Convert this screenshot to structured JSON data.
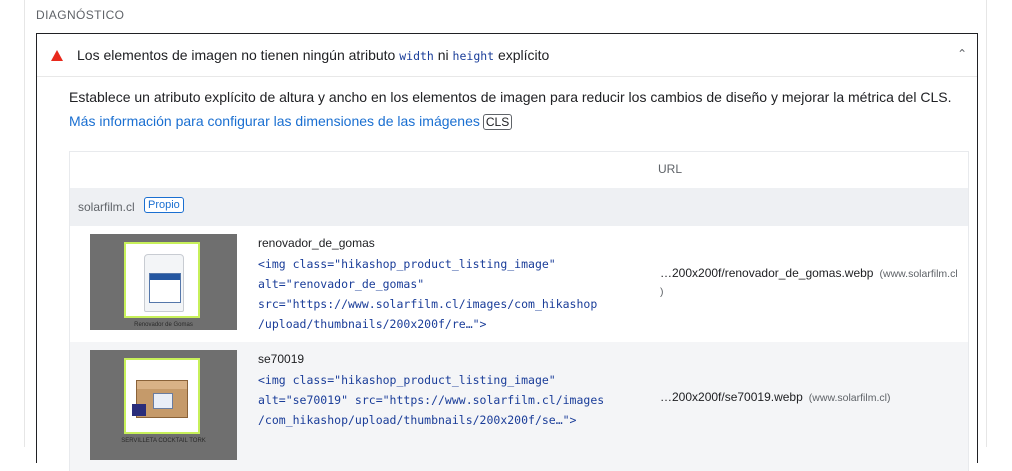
{
  "section": {
    "title": "DIAGNÓSTICO"
  },
  "audit": {
    "title_prefix": "Los elementos de imagen no tienen ningún atributo ",
    "code_width": "width",
    "title_middle": " ni ",
    "code_height": "height",
    "title_suffix": " explícito",
    "description": "Establece un atributo explícito de altura y ancho en los elementos de imagen para reducir los cambios de diseño y mejorar la métrica del CLS.",
    "learn_more": "Más información para configurar las dimensiones de las imágenes",
    "badge": "CLS",
    "icons": {
      "warning": "warning-triangle-icon",
      "collapse": "chevron-up-icon"
    },
    "colors": {
      "warning": "#e8291c",
      "link": "#1a6fd1",
      "code": "#1a3d99"
    }
  },
  "table": {
    "header_url": "URL",
    "group": {
      "name": "solarfilm.cl",
      "badge": "Propio"
    },
    "rows": [
      {
        "node_label": "renovador_de_gomas",
        "snippet": "<img class=\"hikashop_product_listing_image\"\nalt=\"renovador_de_gomas\"\nsrc=\"https://www.solarfilm.cl/images/com_hikashop\n/upload/thumbnails/200x200f/re…\">",
        "url": "…200x200f/renovador_de_gomas.webp",
        "host": "(www.solarfilm.cl",
        "host_close": ")",
        "thumb_caption": "Renovador de Gomas"
      },
      {
        "node_label": "se70019",
        "snippet": "<img class=\"hikashop_product_listing_image\"\nalt=\"se70019\" src=\"https://www.solarfilm.cl/images\n/com_hikashop/upload/thumbnails/200x200f/se…\">",
        "url": "…200x200f/se70019.webp",
        "host": "(www.solarfilm.cl)",
        "thumb_caption": "SERVILLETA COCKTAIL TORK"
      }
    ]
  }
}
